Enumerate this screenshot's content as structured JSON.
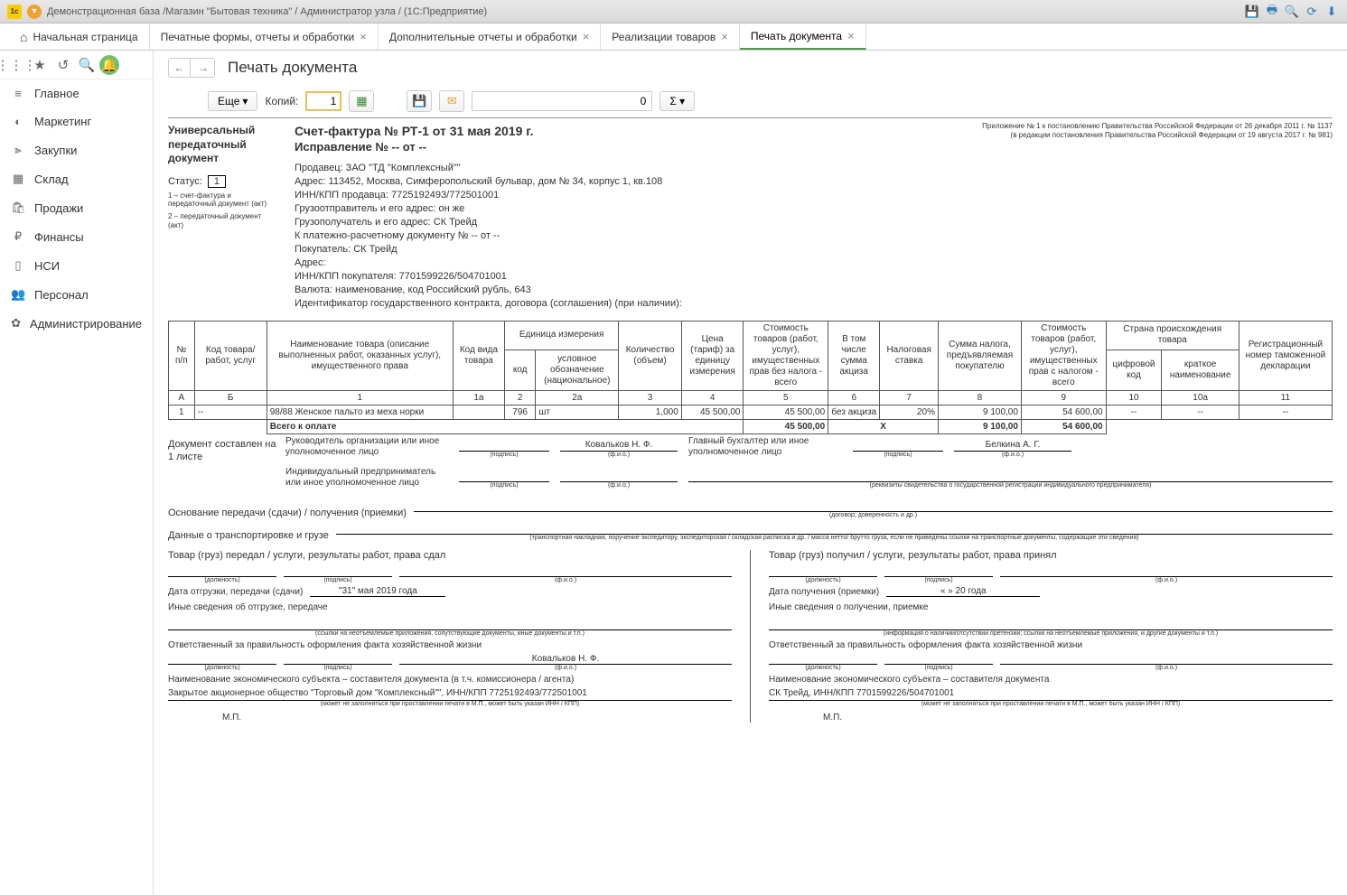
{
  "titlebar": {
    "text": "Демонстрационная база /Магазин \"Бытовая техника\" / Администратор узла / (1С:Предприятие)"
  },
  "tabs": {
    "home": "Начальная страница",
    "items": [
      "Печатные формы, отчеты и обработки",
      "Дополнительные отчеты и обработки",
      "Реализации товаров",
      "Печать документа"
    ]
  },
  "nav": {
    "items": [
      {
        "icon": "≡",
        "label": "Главное"
      },
      {
        "icon": "◐",
        "label": "Маркетинг"
      },
      {
        "icon": "⫸",
        "label": "Закупки"
      },
      {
        "icon": "▦",
        "label": "Склад"
      },
      {
        "icon": "🛍",
        "label": "Продажи"
      },
      {
        "icon": "₽",
        "label": "Финансы"
      },
      {
        "icon": "▯",
        "label": "НСИ"
      },
      {
        "icon": "👥",
        "label": "Персонал"
      },
      {
        "icon": "✿",
        "label": "Администрирование"
      }
    ]
  },
  "page": {
    "title": "Печать документа",
    "more_btn": "Еще",
    "copies_label": "Копий:",
    "copies_value": "1",
    "counter": "0"
  },
  "doc": {
    "left_title": "Универсальный передаточный документ",
    "status_label": "Статус:",
    "status_value": "1",
    "status_note1": "1 – счет-фактура и передаточный документ (акт)",
    "status_note2": "2 – передаточный документ (акт)",
    "invoice_title": "Счет-фактура № РТ-1 от 31 мая 2019 г.",
    "correction": "Исправление № -- от --",
    "right_note1": "Приложение № 1 к постановлению Правительства Российской Федерации от 26 декабря 2011 г. № 1137",
    "right_note2": "(в редакции постановления Правительства Российской Федерации от 19 августа 2017 г. № 981)",
    "seller": "Продавец: ЗАО \"ТД \"Комплексный\"\"",
    "address": "Адрес: 113452, Москва, Симферопольский бульвар, дом № 34, корпус 1, кв.108",
    "inn_seller": "ИНН/КПП продавца: 7725192493/772501001",
    "shipper": "Грузоотправитель и его адрес: он же",
    "consignee": "Грузополучатель и его адрес: СК Трейд",
    "payment_doc": "К платежно-расчетному документу № -- от --",
    "buyer": "Покупатель: СК Трейд",
    "buyer_addr": "Адрес:",
    "inn_buyer": "ИНН/КПП покупателя: 7701599226/504701001",
    "currency": "Валюта: наименование, код Российский рубль, 643",
    "contract_id": "Идентификатор государственного контракта, договора (соглашения) (при наличии):"
  },
  "table": {
    "headers": {
      "h1": "№ п/п",
      "h2": "Код товара/ работ, услуг",
      "h3": "Наименование товара (описание выполненных работ, оказанных услуг), имущественного права",
      "h4": "Код вида товара",
      "h5": "Единица измерения",
      "h5a": "код",
      "h5b": "условное обозначение (национальное)",
      "h6": "Количество (объем)",
      "h7": "Цена (тариф) за единицу измерения",
      "h8": "Стоимость товаров (работ, услуг), имущественных прав без налога - всего",
      "h9": "В том числе сумма акциза",
      "h10": "Налоговая ставка",
      "h11": "Сумма налога, предъявляемая покупателю",
      "h12": "Стоимость товаров (работ, услуг), имущественных прав с налогом - всего",
      "h13": "Страна происхождения товара",
      "h13a": "цифровой код",
      "h13b": "краткое наименование",
      "h14": "Регистрационный номер таможенной декларации"
    },
    "colnums": [
      "А",
      "Б",
      "1",
      "1а",
      "2",
      "2а",
      "3",
      "4",
      "5",
      "6",
      "7",
      "8",
      "9",
      "10",
      "10а",
      "11"
    ],
    "row": {
      "n": "1",
      "code": "--",
      "name": "98/88 Женское пальто из меха норки",
      "kind": "",
      "unit_code": "796",
      "unit": "шт",
      "qty": "1,000",
      "price": "45 500,00",
      "cost_wo": "45 500,00",
      "excise": "без акциза",
      "rate": "20%",
      "tax": "9 100,00",
      "cost_w": "54 600,00",
      "cc": "--",
      "cn": "--",
      "decl": "--"
    },
    "total_label": "Всего к оплате",
    "total_wo": "45 500,00",
    "total_x": "Х",
    "total_tax": "9 100,00",
    "total_w": "54 600,00"
  },
  "signs": {
    "doc_pages": "Документ составлен на 1 листе",
    "head_label": "Руководитель организации или иное уполномоченное лицо",
    "head_name": "Ковальков Н. Ф.",
    "accountant_label": "Главный бухгалтер или иное уполномоченное лицо",
    "accountant_name": "Белкина А. Г.",
    "ip_label": "Индивидуальный предприниматель или иное уполномоченное лицо",
    "podpis": "(подпись)",
    "fio": "(ф.и.о.)",
    "rekvizity": "(реквизиты свидетельства о государственной регистрации индивидуального предпринимателя)"
  },
  "lower": {
    "basis_label": "Основание передачи (сдачи) / получения (приемки)",
    "basis_cap": "(договор; доверенность и др.)",
    "transport_label": "Данные о транспортировке и грузе",
    "transport_cap": "(транспортная накладная, поручение экспедитору, экспедиторская / складская расписка и др. / масса нетто/ брутто груза, если не приведены ссылки на транспортные документы, содержащие эти сведения)",
    "left": {
      "title": "Товар (груз) передал / услуги, результаты работ, права сдал",
      "date_label": "Дата отгрузки, передачи (сдачи)",
      "date_value": "\"31\" мая 2019 года",
      "other_label": "Иные сведения об отгрузке, передаче",
      "other_cap": "(ссылки на неотъемлемые приложения, сопутствующие документы, иные документы и т.п.)",
      "resp_label": "Ответственный за правильность оформления факта хозяйственной жизни",
      "resp_name": "Ковальков Н. Ф.",
      "entity_label": "Наименование экономического субъекта – составителя документа (в т.ч. комиссионера / агента)",
      "entity_value": "Закрытое акционерное общество \"Торговый дом \"Комплексный\"\", ИНН/КПП 7725192493/772501001",
      "entity_cap": "(может не заполняться при проставлении печати в М.П., может быть указан ИНН / КПП)"
    },
    "right": {
      "title": "Товар (груз) получил / услуги, результаты работ, права принял",
      "date_label": "Дата получения (приемки)",
      "date_value": "«      »                      20      года",
      "other_label": "Иные сведения о получении, приемке",
      "other_cap": "(информация о наличии/отсутствии претензии; ссылки на неотъемлемые приложения, и другие документы и т.п.)",
      "resp_label": "Ответственный за правильность оформления факта хозяйственной жизни",
      "entity_label": "Наименование экономического субъекта – составителя документа",
      "entity_value": "СК Трейд, ИНН/КПП 7701599226/504701001",
      "entity_cap": "(может не заполняться при проставлении печати в М.П., может быть указан ИНН / КПП)"
    },
    "dolzh": "(должность)",
    "mp": "М.П."
  }
}
